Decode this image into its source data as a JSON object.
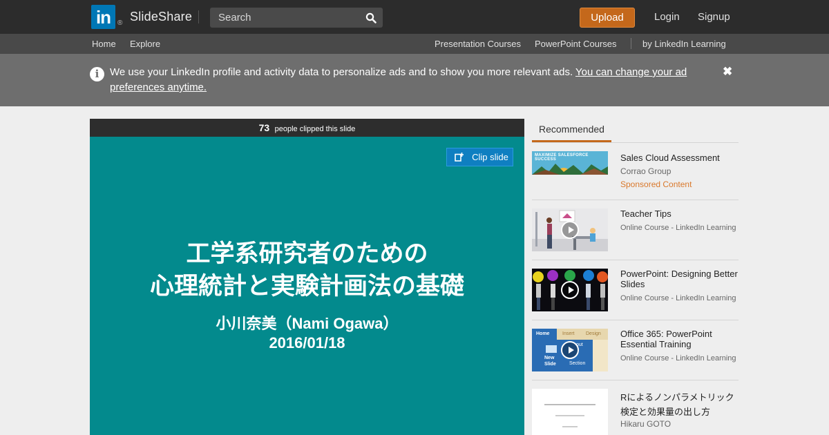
{
  "header": {
    "logo_mark": "in",
    "logo_reg": "®",
    "brand": "SlideShare",
    "search_placeholder": "Search",
    "upload_label": "Upload",
    "login_label": "Login",
    "signup_label": "Signup"
  },
  "subnav": {
    "home": "Home",
    "explore": "Explore",
    "presentation_courses": "Presentation Courses",
    "powerpoint_courses": "PowerPoint Courses",
    "linkedin_learning": "by LinkedIn Learning"
  },
  "notice": {
    "text": "We use your LinkedIn profile and activity data to personalize ads and to show you more relevant ads.",
    "link": "You can change your ad preferences anytime.",
    "close": "✖"
  },
  "player": {
    "clip_count": "73",
    "clip_count_text": "people clipped this slide",
    "clip_button": "Clip slide",
    "slide_title_line1": "工学系研究者のための",
    "slide_title_line2": "心理統計と実験計画法の基礎",
    "slide_author": "小川奈美（Nami Ogawa）",
    "slide_date": "2016/01/18"
  },
  "recommended": {
    "tab_label": "Recommended",
    "items": [
      {
        "title": "Sales Cloud Assessment",
        "subtitle": "Corrao Group",
        "sponsored": "Sponsored Content",
        "thumb_text": "MAXIMIZE SALESFORCE SUCCESS"
      },
      {
        "title": "Teacher Tips",
        "subtitle": "Online Course - LinkedIn Learning"
      },
      {
        "title": "PowerPoint: Designing Better Slides",
        "subtitle": "Online Course - LinkedIn Learning"
      },
      {
        "title": "Office 365: PowerPoint Essential Training",
        "subtitle": "Online Course - LinkedIn Learning",
        "thumb_tabs": [
          "Home",
          "Insert",
          "Design"
        ],
        "thumb_new_slide": "New Slide",
        "thumb_layout": "out",
        "thumb_section": "Section"
      },
      {
        "title": "Rによるノンパラメトリック検定と効果量の出し方",
        "subtitle": "Hikaru GOTO"
      }
    ]
  },
  "colors": {
    "accent": "#c4681b",
    "slide_bg": "#038a8d",
    "linkedin_blue": "#0077b5",
    "clip_blue": "#0f7fc1"
  }
}
